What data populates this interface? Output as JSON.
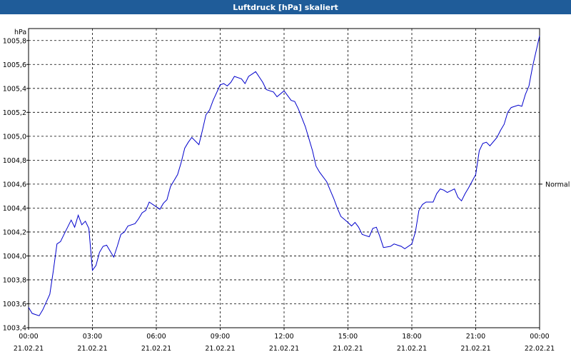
{
  "window": {
    "title": "Luftdruck [hPa] skaliert"
  },
  "colors": {
    "titlebar": "#1f5c99",
    "line": "#0000cc",
    "grid": "#000000"
  },
  "chart_data": {
    "type": "line",
    "title": "Luftdruck [hPa] skaliert",
    "ylabel": "hPa",
    "ylim": [
      1003.4,
      1005.9
    ],
    "grid": true,
    "y_ticks": [
      {
        "value": 1003.4,
        "label": "1003,4"
      },
      {
        "value": 1003.6,
        "label": "1003,6"
      },
      {
        "value": 1003.8,
        "label": "1003,8"
      },
      {
        "value": 1004.0,
        "label": "1004,0"
      },
      {
        "value": 1004.2,
        "label": "1004,2"
      },
      {
        "value": 1004.4,
        "label": "1004,4"
      },
      {
        "value": 1004.6,
        "label": "1004,6"
      },
      {
        "value": 1004.8,
        "label": "1004,8"
      },
      {
        "value": 1005.0,
        "label": "1005,0"
      },
      {
        "value": 1005.2,
        "label": "1005,2"
      },
      {
        "value": 1005.4,
        "label": "1005,4"
      },
      {
        "value": 1005.6,
        "label": "1005,6"
      },
      {
        "value": 1005.8,
        "label": "1005,8"
      }
    ],
    "x_ticks": [
      {
        "time": "00:00",
        "date": "21.02.21"
      },
      {
        "time": "03:00",
        "date": "21.02.21"
      },
      {
        "time": "06:00",
        "date": "21.02.21"
      },
      {
        "time": "09:00",
        "date": "21.02.21"
      },
      {
        "time": "12:00",
        "date": "21.02.21"
      },
      {
        "time": "15:00",
        "date": "21.02.21"
      },
      {
        "time": "18:00",
        "date": "21.02.21"
      },
      {
        "time": "21:00",
        "date": "21.02.21"
      },
      {
        "time": "00:00",
        "date": "22.02.21"
      }
    ],
    "reference_label": {
      "text": "Normal",
      "value": 1004.6
    },
    "series": [
      {
        "x": [
          "21.02.21 00:00",
          "21.02.21 00:10",
          "21.02.21 00:20",
          "21.02.21 00:30",
          "21.02.21 00:40",
          "21.02.21 01:00",
          "21.02.21 01:10",
          "21.02.21 01:20",
          "21.02.21 01:30",
          "21.02.21 01:40",
          "21.02.21 02:00",
          "21.02.21 02:10",
          "21.02.21 02:20",
          "21.02.21 02:30",
          "21.02.21 02:40",
          "21.02.21 02:50",
          "21.02.21 03:00",
          "21.02.21 03:10",
          "21.02.21 03:20",
          "21.02.21 03:30",
          "21.02.21 03:40",
          "21.02.21 04:00",
          "21.02.21 04:10",
          "21.02.21 04:20",
          "21.02.21 04:30",
          "21.02.21 04:40",
          "21.02.21 05:00",
          "21.02.21 05:10",
          "21.02.21 05:20",
          "21.02.21 05:30",
          "21.02.21 05:40",
          "21.02.21 06:00",
          "21.02.21 06:10",
          "21.02.21 06:20",
          "21.02.21 06:30",
          "21.02.21 06:40",
          "21.02.21 07:00",
          "21.02.21 07:10",
          "21.02.21 07:20",
          "21.02.21 07:30",
          "21.02.21 07:40",
          "21.02.21 08:00",
          "21.02.21 08:10",
          "21.02.21 08:20",
          "21.02.21 08:30",
          "21.02.21 08:40",
          "21.02.21 09:00",
          "21.02.21 09:10",
          "21.02.21 09:20",
          "21.02.21 09:30",
          "21.02.21 09:40",
          "21.02.21 10:00",
          "21.02.21 10:10",
          "21.02.21 10:20",
          "21.02.21 10:30",
          "21.02.21 10:40",
          "21.02.21 11:00",
          "21.02.21 11:10",
          "21.02.21 11:20",
          "21.02.21 11:30",
          "21.02.21 11:40",
          "21.02.21 12:00",
          "21.02.21 12:10",
          "21.02.21 12:20",
          "21.02.21 12:30",
          "21.02.21 12:40",
          "21.02.21 13:00",
          "21.02.21 13:10",
          "21.02.21 13:20",
          "21.02.21 13:30",
          "21.02.21 13:40",
          "21.02.21 14:00",
          "21.02.21 14:10",
          "21.02.21 14:20",
          "21.02.21 14:30",
          "21.02.21 14:40",
          "21.02.21 15:00",
          "21.02.21 15:10",
          "21.02.21 15:20",
          "21.02.21 15:30",
          "21.02.21 15:40",
          "21.02.21 16:00",
          "21.02.21 16:10",
          "21.02.21 16:20",
          "21.02.21 16:30",
          "21.02.21 16:40",
          "21.02.21 17:00",
          "21.02.21 17:10",
          "21.02.21 17:20",
          "21.02.21 17:30",
          "21.02.21 17:40",
          "21.02.21 18:00",
          "21.02.21 18:10",
          "21.02.21 18:20",
          "21.02.21 18:30",
          "21.02.21 18:40",
          "21.02.21 19:00",
          "21.02.21 19:10",
          "21.02.21 19:20",
          "21.02.21 19:30",
          "21.02.21 19:40",
          "21.02.21 20:00",
          "21.02.21 20:10",
          "21.02.21 20:20",
          "21.02.21 20:30",
          "21.02.21 20:40",
          "21.02.21 21:00",
          "21.02.21 21:10",
          "21.02.21 21:20",
          "21.02.21 21:30",
          "21.02.21 21:40",
          "21.02.21 22:00",
          "21.02.21 22:10",
          "21.02.21 22:20",
          "21.02.21 22:30",
          "21.02.21 22:40",
          "21.02.21 23:00",
          "21.02.21 23:10",
          "21.02.21 23:20",
          "21.02.21 23:30",
          "21.02.21 23:40",
          "22.02.21 00:00"
        ],
        "y": [
          1003.57,
          1003.52,
          1003.51,
          1003.5,
          1003.55,
          1003.68,
          1003.88,
          1004.1,
          1004.12,
          1004.18,
          1004.3,
          1004.24,
          1004.34,
          1004.26,
          1004.29,
          1004.23,
          1003.88,
          1003.92,
          1004.03,
          1004.08,
          1004.09,
          1003.99,
          1004.08,
          1004.18,
          1004.2,
          1004.25,
          1004.27,
          1004.31,
          1004.36,
          1004.38,
          1004.45,
          1004.41,
          1004.39,
          1004.44,
          1004.47,
          1004.58,
          1004.68,
          1004.78,
          1004.9,
          1004.95,
          1004.99,
          1004.93,
          1005.05,
          1005.18,
          1005.22,
          1005.3,
          1005.43,
          1005.44,
          1005.42,
          1005.45,
          1005.5,
          1005.48,
          1005.44,
          1005.5,
          1005.52,
          1005.54,
          1005.45,
          1005.39,
          1005.38,
          1005.37,
          1005.33,
          1005.38,
          1005.34,
          1005.3,
          1005.29,
          1005.23,
          1005.08,
          1004.98,
          1004.88,
          1004.75,
          1004.7,
          1004.62,
          1004.55,
          1004.48,
          1004.4,
          1004.33,
          1004.28,
          1004.25,
          1004.28,
          1004.24,
          1004.18,
          1004.16,
          1004.23,
          1004.24,
          1004.16,
          1004.07,
          1004.08,
          1004.1,
          1004.09,
          1004.08,
          1004.06,
          1004.1,
          1004.2,
          1004.38,
          1004.43,
          1004.45,
          1004.45,
          1004.52,
          1004.56,
          1004.55,
          1004.53,
          1004.56,
          1004.49,
          1004.46,
          1004.52,
          1004.57,
          1004.68,
          1004.88,
          1004.94,
          1004.95,
          1004.92,
          1004.99,
          1005.05,
          1005.1,
          1005.2,
          1005.24,
          1005.26,
          1005.25,
          1005.35,
          1005.42,
          1005.58,
          1005.84
        ]
      }
    ]
  }
}
